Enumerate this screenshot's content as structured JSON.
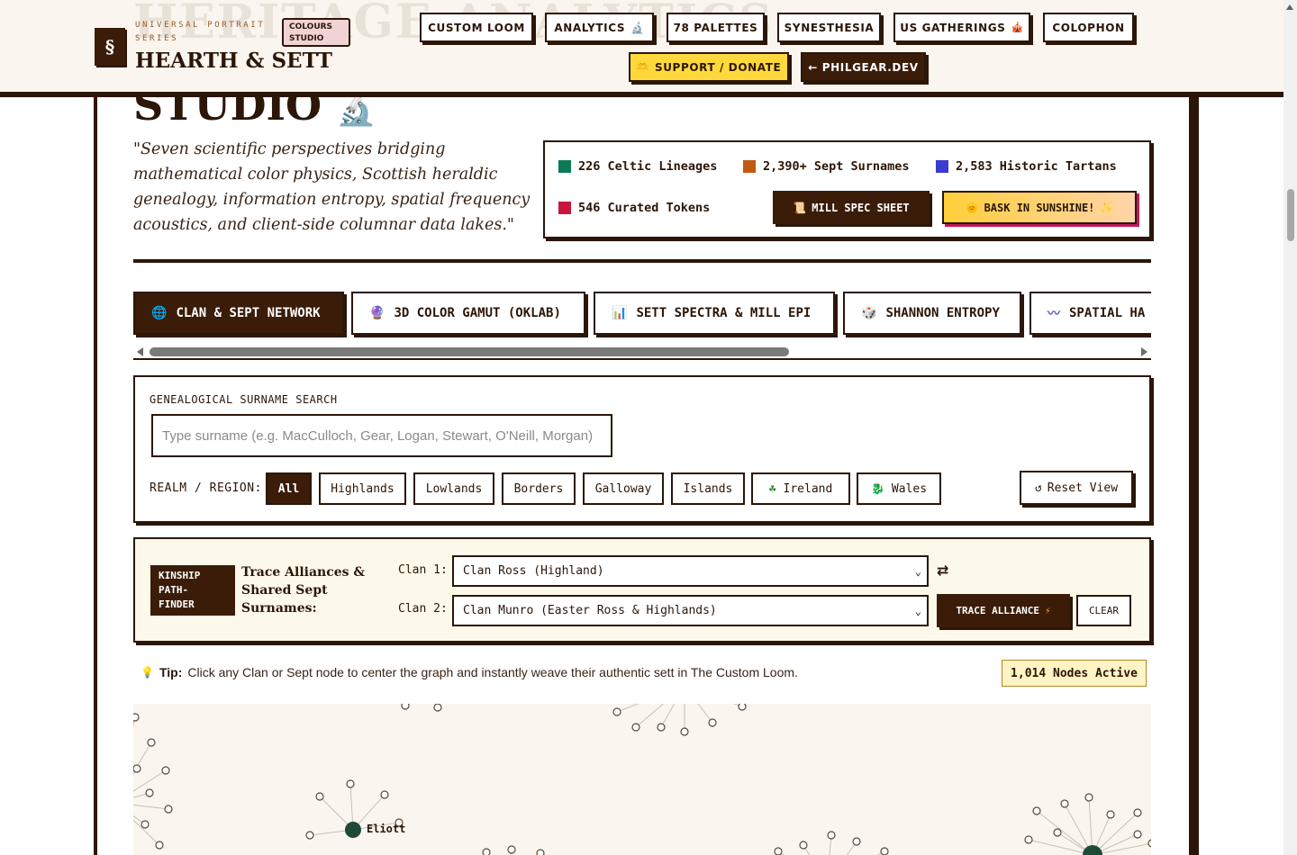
{
  "header": {
    "ghost_title": "HERITAGE ANALYTICS",
    "logo_glyph": "§",
    "brand_sub": "UNIVERSAL PORTRAIT SERIES",
    "brand_badge": "COLOURS STUDIO",
    "brand_name": "HEARTH & SETT",
    "nav": [
      {
        "label": "CUSTOM LOOM",
        "icon": ""
      },
      {
        "label": "ANALYTICS",
        "icon": "microscope-icon"
      },
      {
        "label": "78 PALETTES",
        "icon": ""
      },
      {
        "label": "SYNESTHESIA",
        "icon": ""
      },
      {
        "label": "US GATHERINGS",
        "icon": "tent-icon"
      },
      {
        "label": "COLOPHON",
        "icon": ""
      }
    ],
    "support_label": "SUPPORT / DONATE",
    "phil_label": "← PHILGEAR.DEV"
  },
  "hero": {
    "title": "STUDIO",
    "quote": "\"Seven scientific perspectives bridging mathematical color physics, Scottish heraldic genealogy, information entropy, spatial frequency acoustics, and client-side columnar data lakes.\"",
    "stats": [
      {
        "label": "226 Celtic Lineages",
        "color": "#0b7a55"
      },
      {
        "label": "2,390+ Sept Surnames",
        "color": "#c05a12"
      },
      {
        "label": "2,583 Historic Tartans",
        "color": "#3b3bd1"
      },
      {
        "label": "546 Curated Tokens",
        "color": "#c8163f"
      }
    ],
    "mill_label": "MILL SPEC SHEET",
    "bask_label": "BASK IN SUNSHINE!"
  },
  "tabs": [
    {
      "label": "CLAN & SEPT NETWORK",
      "icon": "globe-icon",
      "active": true
    },
    {
      "label": "3D COLOR GAMUT (OKLAB)",
      "icon": "orb-icon",
      "active": false
    },
    {
      "label": "SETT SPECTRA & MILL EPI",
      "icon": "bar-chart-icon",
      "active": false
    },
    {
      "label": "SHANNON ENTROPY",
      "icon": "dice-icon",
      "active": false
    },
    {
      "label": "SPATIAL HA",
      "icon": "wave-icon",
      "active": false
    }
  ],
  "search": {
    "label": "GENEALOGICAL SURNAME SEARCH",
    "placeholder": "Type surname (e.g. MacCulloch, Gear, Logan, Stewart, O'Neill, Morgan)",
    "value": "",
    "region_label": "REALM / REGION:",
    "regions": [
      {
        "label": "All",
        "icon": "",
        "active": true
      },
      {
        "label": "Highlands",
        "icon": "",
        "active": false
      },
      {
        "label": "Lowlands",
        "icon": "",
        "active": false
      },
      {
        "label": "Borders",
        "icon": "",
        "active": false
      },
      {
        "label": "Galloway",
        "icon": "",
        "active": false
      },
      {
        "label": "Islands",
        "icon": "",
        "active": false
      },
      {
        "label": "Ireland",
        "icon": "shamrock-icon",
        "active": false
      },
      {
        "label": "Wales",
        "icon": "dragon-icon",
        "active": false
      }
    ],
    "reset_label": "Reset View"
  },
  "kinship": {
    "tag": "KINSHIP PATH- FINDER",
    "title": "Trace Alliances & Shared Sept Surnames:",
    "clan1_label": "Clan 1:",
    "clan1_value": "Clan Ross (Highland)",
    "clan2_label": "Clan 2:",
    "clan2_value": "Clan Munro (Easter Ross & Highlands)",
    "trace_label": "TRACE ALLIANCE",
    "clear_label": "CLEAR"
  },
  "tip": {
    "prefix": "Tip:",
    "text": "Click any Clan or Sept node to center the graph and instantly weave their authentic sett in The Custom Loom."
  },
  "nodes_badge": "1,014 Nodes Active",
  "graph": {
    "labels": [
      "Eliott"
    ],
    "hub_color": "#1f4a38",
    "leaf_stroke": "#5a4636",
    "edge_color": "#c9bfb2"
  }
}
